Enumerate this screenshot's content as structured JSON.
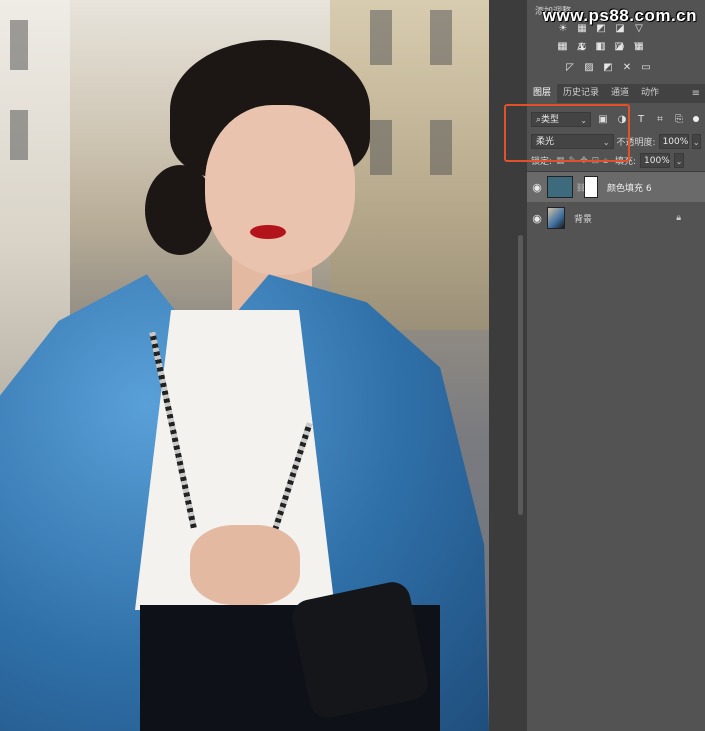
{
  "watermark": "www.ps88.com.cn",
  "adjustments_panel": {
    "title": "添加调整",
    "row1_icons": [
      "brightness-contrast-icon",
      "levels-icon",
      "curves-icon",
      "exposure-icon",
      "triangle-icon"
    ],
    "row2_icons": [
      "vibrance-icon",
      "balance-icon",
      "bw-icon",
      "camera-icon",
      "grid-icon"
    ],
    "row3_icons": [
      "invert-icon",
      "posterize-icon",
      "threshold-icon",
      "selective-color-icon",
      "gradient-map-icon"
    ]
  },
  "tabs": [
    "图层",
    "历史记录",
    "通道",
    "动作"
  ],
  "filter": {
    "kind_label": "类型",
    "icon_glyphs": [
      "▣",
      "◑",
      "T",
      "⌗",
      "⎘"
    ]
  },
  "blend": {
    "mode": "柔光",
    "opacity_label": "不透明度:",
    "opacity_value": "100%"
  },
  "lock": {
    "label": "锁定:",
    "fill_label": "填充:",
    "fill_value": "100%"
  },
  "layers": [
    {
      "name": "颜色填充 6",
      "selected": true
    },
    {
      "name": "背景",
      "selected": false
    }
  ],
  "colors": {
    "accent_highlight": "#e2522a",
    "fill_swatch": "#3d6a7d",
    "panel_bg": "#535353"
  }
}
